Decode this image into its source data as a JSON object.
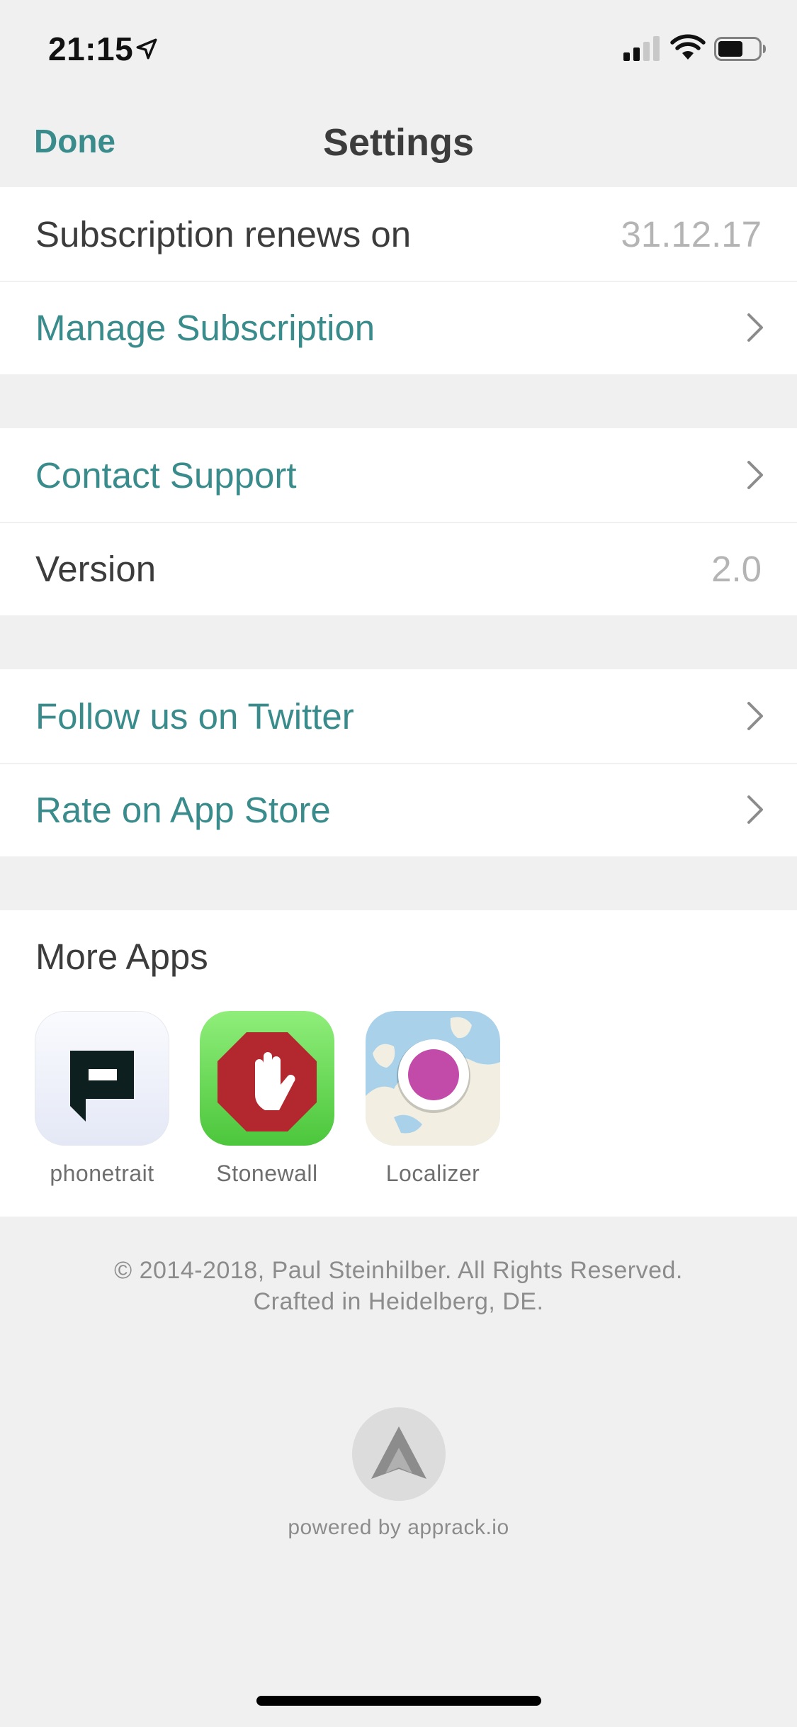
{
  "status_bar": {
    "time": "21:15",
    "icons": [
      "location-arrow-icon",
      "cellular-signal-icon",
      "wifi-icon",
      "battery-icon"
    ]
  },
  "nav": {
    "done_label": "Done",
    "title": "Settings"
  },
  "section_subscription": {
    "renews_label": "Subscription renews on",
    "renews_value": "31.12.17",
    "manage_label": "Manage Subscription"
  },
  "section_support": {
    "contact_label": "Contact Support",
    "version_label": "Version",
    "version_value": "2.0"
  },
  "section_social": {
    "twitter_label": "Follow us on Twitter",
    "rate_label": "Rate on App Store"
  },
  "more_apps": {
    "title": "More Apps",
    "apps": [
      {
        "name": "phonetrait",
        "icon": "phonetrait-app-icon"
      },
      {
        "name": "Stonewall",
        "icon": "stonewall-app-icon"
      },
      {
        "name": "Localizer",
        "icon": "localizer-app-icon"
      }
    ]
  },
  "footer": {
    "copyright": "© 2014-2018, Paul Steinhilber. All Rights Reserved.",
    "crafted": "Crafted in Heidelberg, DE.",
    "powered_by": "powered by apprack.io"
  },
  "colors": {
    "accent": "#3a8c8c",
    "background": "#f0f0f0",
    "value_gray": "#b4b4b4",
    "text": "#3c3c3c"
  }
}
